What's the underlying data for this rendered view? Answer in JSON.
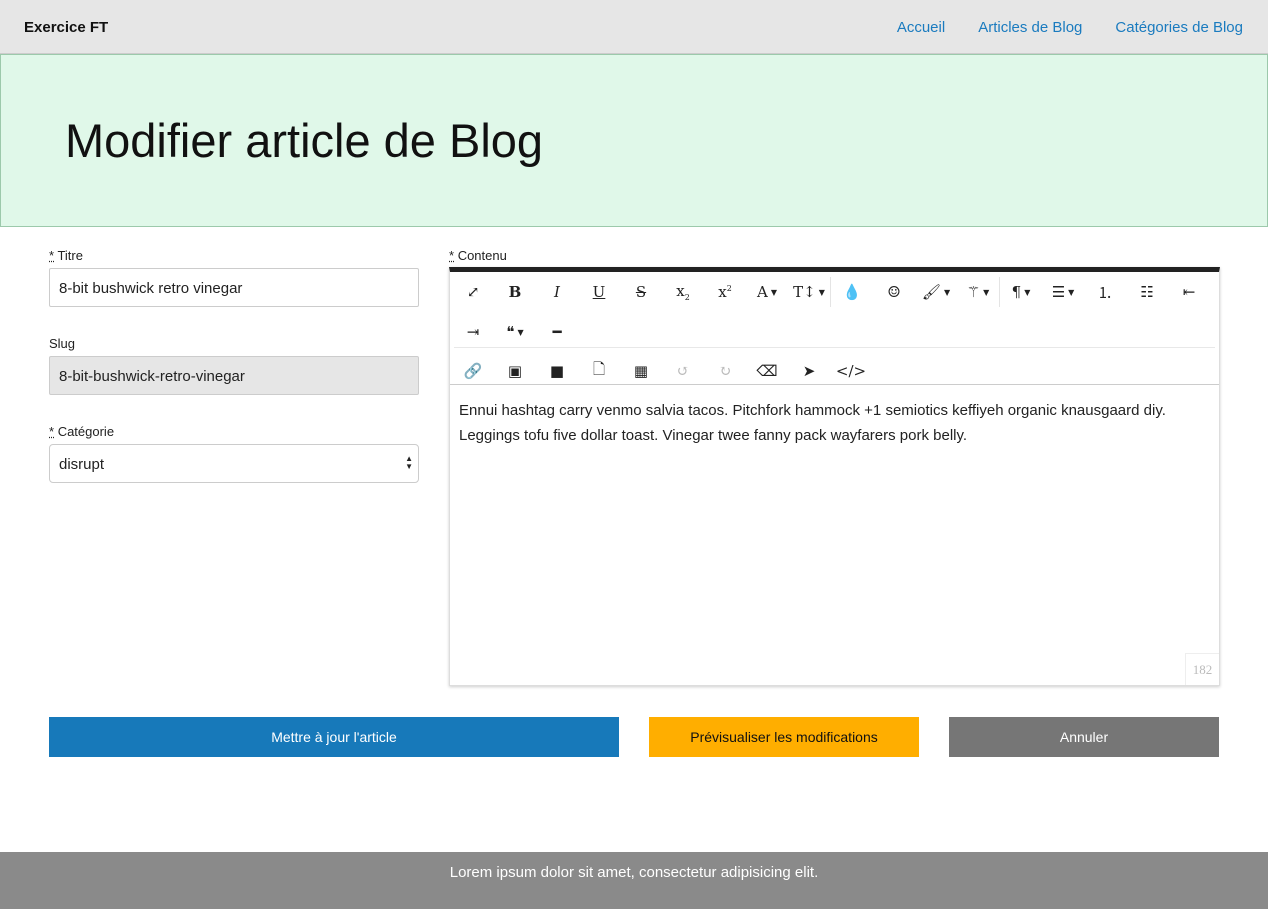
{
  "nav": {
    "brand": "Exercice FT",
    "links": [
      "Accueil",
      "Articles de Blog",
      "Catégories de Blog"
    ]
  },
  "hero": {
    "title": "Modifier article de Blog"
  },
  "form": {
    "required_mark": "*",
    "title_label": "Titre",
    "title_value": "8-bit bushwick retro vinegar",
    "slug_label": "Slug",
    "slug_value": "8-bit-bushwick-retro-vinegar",
    "category_label": "Catégorie",
    "category_value": "disrupt",
    "content_label": "Contenu",
    "content_text": "Ennui hashtag carry venmo salvia tacos. Pitchfork hammock +1 semiotics keffiyeh organic knausgaard diy. Leggings tofu five dollar toast. Vinegar twee fanny pack wayfarers pork belly.",
    "char_count": "182"
  },
  "toolbar": {
    "row1": [
      "fullscreen",
      "bold",
      "italic",
      "underline",
      "strikethrough",
      "subscript",
      "superscript",
      "font-name",
      "font-size",
      "|",
      "color",
      "emoji",
      "paint-brush",
      "magic-wand",
      "|",
      "paragraph",
      "align",
      "ordered-list",
      "unordered-list",
      "outdent"
    ],
    "row2": [
      "indent",
      "quote",
      "horizontal-rule"
    ],
    "row3": [
      "link",
      "image",
      "video",
      "file",
      "table",
      "undo",
      "redo",
      "eraser",
      "select",
      "code-view"
    ],
    "disabled": [
      "undo",
      "redo"
    ],
    "with_caret": [
      "font-name",
      "font-size",
      "paint-brush",
      "magic-wand",
      "paragraph",
      "align",
      "quote"
    ]
  },
  "buttons": {
    "update": "Mettre à jour l'article",
    "preview": "Prévisualiser les modifications",
    "cancel": "Annuler"
  },
  "colors": {
    "primary": "#1779ba",
    "warning": "#ffae00",
    "secondary": "#767676",
    "hero_bg": "#e0f8e9",
    "footer": "#8a8a8a"
  },
  "footer": {
    "text": "Lorem ipsum dolor sit amet, consectetur adipisicing elit."
  }
}
